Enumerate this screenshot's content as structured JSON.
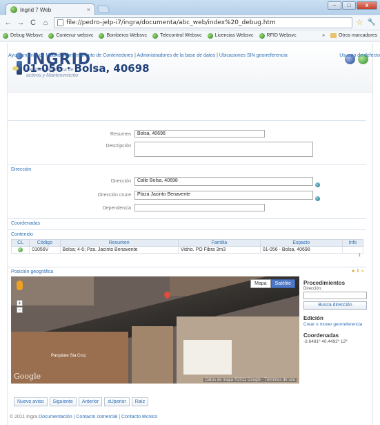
{
  "browser": {
    "tab_title": "Ingrid 7 Web",
    "tab_close": "×",
    "url": "file://pedro-jelp-i7/ingra/documenta/abc_web/index%20_debug.htm",
    "bookmarks": [
      "Debug Websvc",
      "Contenur websvc",
      "Bomberos Websvc",
      "Telecontrol Websvc",
      "Licencias Websvc",
      "RFID Websvc"
    ],
    "bookmarks_more": "»",
    "other_bookmarks": "Otros marcadores",
    "win_min": "–",
    "win_max": "□",
    "win_close": "x"
  },
  "app": {
    "logo_name": "INGRID",
    "logo_tag1": "Gestión geográfica de",
    "logo_tag2": "activos y Mantenimiento"
  },
  "breadcrumb": {
    "items": [
      "Ayuntamiento de Madrid. Mantenimiento de Contenedores",
      "Administradores de la base de datos",
      "Ubicaciones SIN georreferencia"
    ],
    "sep": " | "
  },
  "default_user": "Usuario de defecto",
  "page_title": "01-056 · Bolsa, 40698",
  "form": {
    "resumen_label": "Resumen",
    "resumen_value": "Bolsa, 40698",
    "descripcion_label": "Descripción",
    "descripcion_value": ""
  },
  "direccion": {
    "section": "Dirección",
    "direccion_label": "Dirección",
    "direccion_value": "Calle Bolsa, 40698",
    "cruce_label": "Dirección cruce",
    "cruce_value": "Plaza Jacinto Benavente",
    "dependencia_label": "Dependencia",
    "dependencia_value": ""
  },
  "coordenadas_section": "Coordenadas",
  "contenido": {
    "section": "Contenido",
    "headers": [
      "CL",
      "Código",
      "Resumen",
      "Familia",
      "Espacio",
      "Info"
    ],
    "rows": [
      [
        "",
        "01056V",
        "Bolsa; 4-6; Pza. Jacinto Benavente",
        "Vidrio. PO Fibra 3m3",
        "01-056 - Bolsa, 40698",
        ""
      ]
    ],
    "pager": "1"
  },
  "posicion": {
    "section": "Posición geográfica",
    "map_type_map": "Mapa",
    "map_type_sat": "Satélite",
    "google": "Google",
    "copyright": "Datos de mapa ©2011 Google - Términos de uso",
    "parking": "Parquiate Sta Cruz"
  },
  "side": {
    "proc_title": "Procedimientos",
    "dir_label": "Dirección:",
    "busca_btn": "Busca dirección",
    "edicion_title": "Edición",
    "edicion_link": "Crear o mover georreferencia",
    "coord_title": "Coordenadas",
    "coord_value": "-3.6481º 40.4492º 12ª"
  },
  "actions": [
    "Nuevo aviso",
    "Siguiente",
    "Anterior",
    "sUperior",
    "Raíz"
  ],
  "footer": {
    "copy": "© 2011 Ingra",
    "links": [
      "Documentación",
      "Contacto comercial",
      "Contacto técnico"
    ]
  }
}
